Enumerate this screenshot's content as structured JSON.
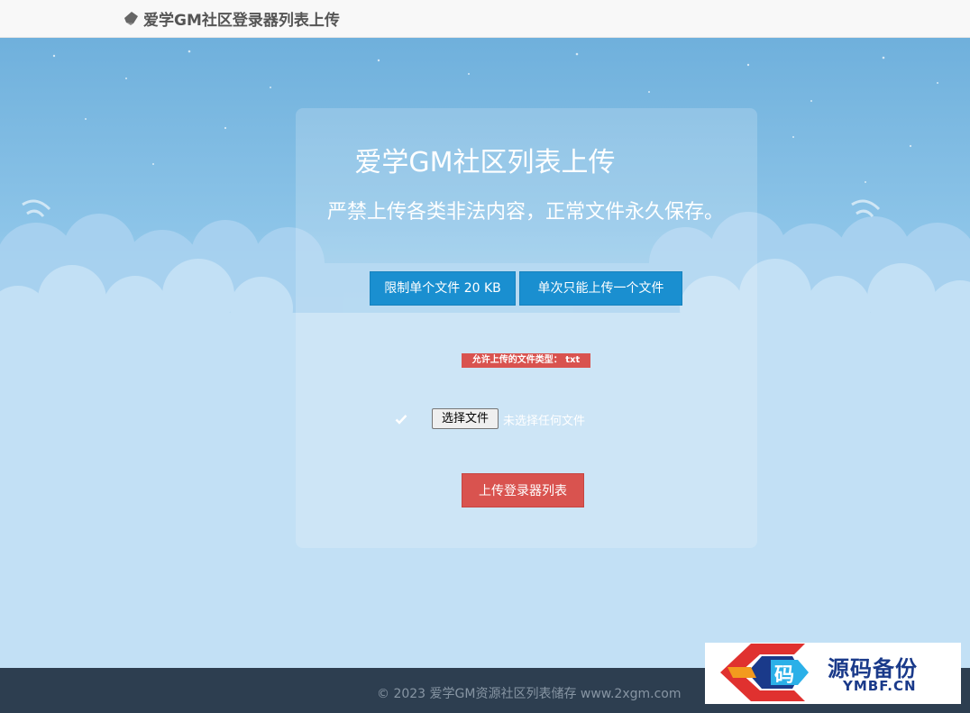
{
  "navbar": {
    "brand_icon": "pen-icon",
    "brand_text": "爱学GM社区登录器列表上传"
  },
  "panel": {
    "title": "爱学GM社区列表上传",
    "subtitle": "严禁上传各类非法内容，正常文件永久保存。",
    "limit_button": "限制单个文件 20 KB",
    "once_button": "单次只能上传一个文件",
    "allowed_types_label": "允许上传的文件类型： txt",
    "file_input": {
      "button_label": "选择文件",
      "status": "未选择任何文件",
      "icon": "check-icon"
    },
    "upload_button": "上传登录器列表"
  },
  "footer": {
    "copyright": "© 2023 爱学GM资源社区列表储存 www.2xgm.com"
  },
  "watermark": {
    "main": "源码备份",
    "sub": "YMBF.CN",
    "logo_char": "码"
  },
  "colors": {
    "info_button": "#1a8fd0",
    "danger": "#d9534f",
    "footer_bg": "#2d3e50",
    "nav_bg": "#f8f8f8",
    "watermark_text": "#1a3a8a"
  }
}
